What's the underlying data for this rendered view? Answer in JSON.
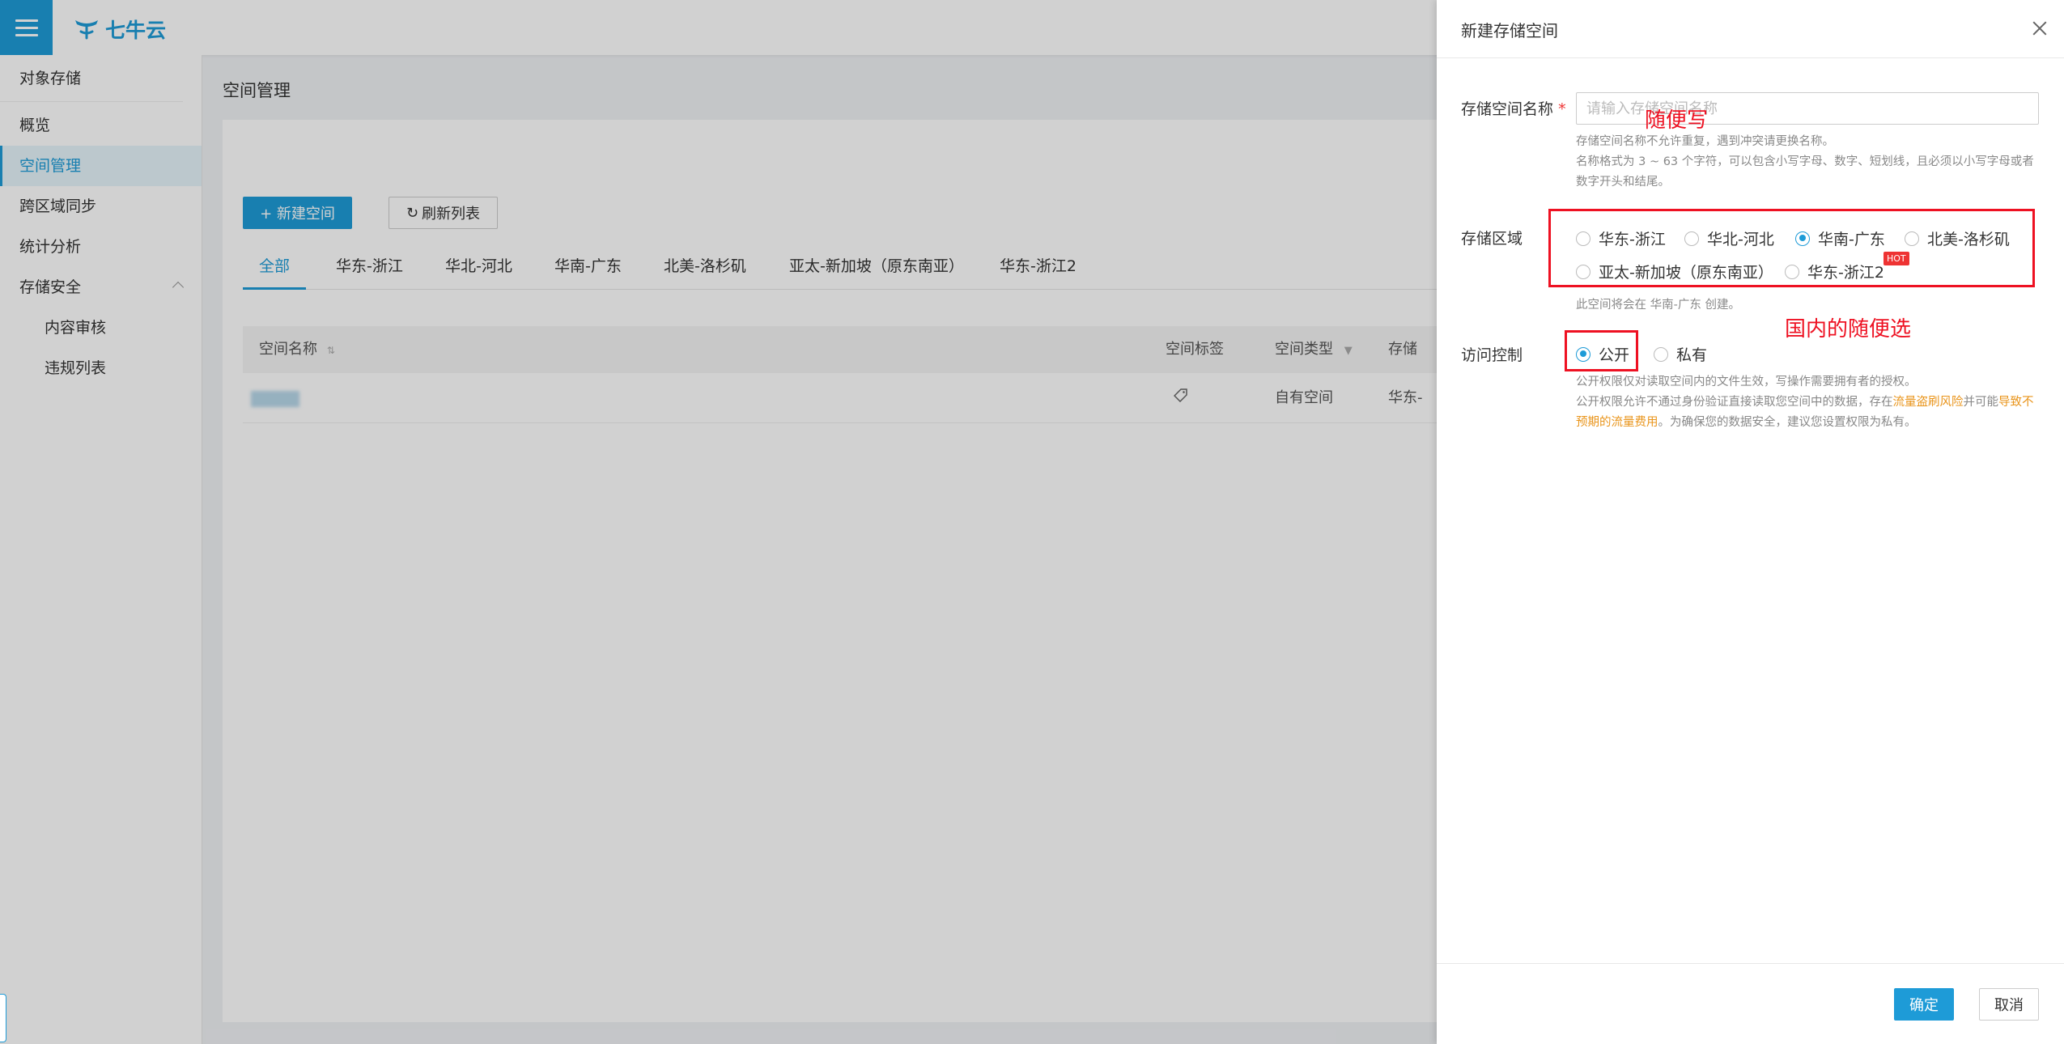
{
  "brand": {
    "logo_text": "七牛云"
  },
  "sidebar": {
    "title": "对象存储",
    "items": [
      {
        "label": "概览"
      },
      {
        "label": "空间管理"
      },
      {
        "label": "跨区域同步"
      },
      {
        "label": "统计分析"
      },
      {
        "label": "存储安全"
      },
      {
        "label": "内容审核"
      },
      {
        "label": "违规列表"
      }
    ]
  },
  "main": {
    "breadcrumb": "空间管理",
    "new_bucket_button": "+ 新建空间",
    "refresh_button": "刷新列表",
    "tabs": [
      "全部",
      "华东-浙江",
      "华北-河北",
      "华南-广东",
      "北美-洛杉矶",
      "亚太-新加坡（原东南亚）",
      "华东-浙江2"
    ],
    "table": {
      "columns": [
        "空间名称",
        "空间标签",
        "空间类型",
        "存储"
      ],
      "rows": [
        {
          "type": "自有空间",
          "region": "华东-"
        }
      ]
    }
  },
  "drawer": {
    "title": "新建存储空间",
    "name_label": "存储空间名称",
    "required_mark": "*",
    "name_placeholder": "请输入存储空间名称",
    "name_hint_1": "存储空间名称不允许重复，遇到冲突请更换名称。",
    "name_hint_2": "名称格式为 3 ~ 63 个字符，可以包含小写字母、数字、短划线，且必须以小写字母或者数字开头和结尾。",
    "region_label": "存储区域",
    "regions": [
      "华东-浙江",
      "华北-河北",
      "华南-广东",
      "北美-洛杉矶",
      "亚太-新加坡（原东南亚）",
      "华东-浙江2"
    ],
    "selected_region": "华南-广东",
    "hot_badge": "HOT",
    "region_hint": "此空间将会在 华南-广东 创建。",
    "access_label": "访问控制",
    "access_options": [
      "公开",
      "私有"
    ],
    "selected_access": "公开",
    "access_hint_1": "公开权限仅对读取空间内的文件生效，写操作需要拥有者的授权。",
    "access_hint_2a": "公开权限允许不通过身份验证直接读取您空间中的数据，存在",
    "access_hint_2_warn1": "流量盗刷风险",
    "access_hint_2b": "并可能",
    "access_hint_2_warn2": "导致不预期的流量费用",
    "access_hint_2c": "。为确保您的数据安全，建议您设置权限为私有。",
    "ok_button": "确定",
    "cancel_button": "取消"
  },
  "annotations": {
    "name_note": "随便写",
    "region_note": "国内的随便选"
  },
  "colors": {
    "accent": "#1e9bd7",
    "annotation_red": "#e11122",
    "warning": "#e9941a"
  }
}
